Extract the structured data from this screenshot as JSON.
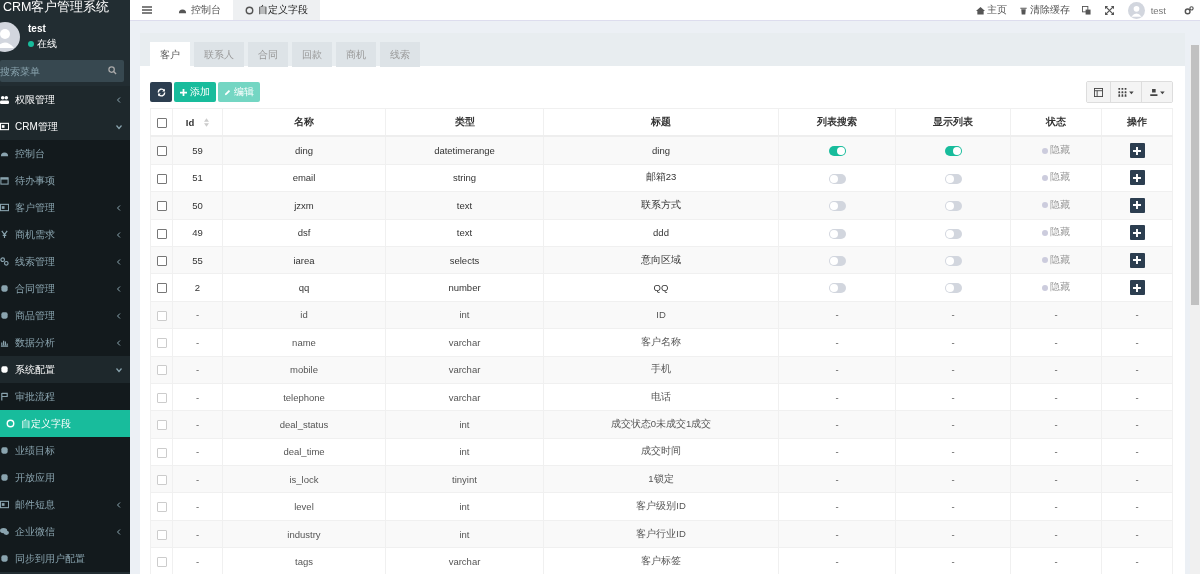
{
  "sidebar": {
    "title": "CRM客户管理系统",
    "user": {
      "name": "test",
      "status": "在线",
      "online": true
    },
    "search": {
      "placeholder": "搜索菜单"
    },
    "items": [
      {
        "label": "权限管理",
        "expanded": false
      },
      {
        "label": "CRM管理",
        "expanded": true,
        "children": [
          {
            "label": "控制台",
            "selected": false
          },
          {
            "label": "待办事项",
            "selected": false
          },
          {
            "label": "客户管理",
            "expanded": false
          },
          {
            "label": "商机需求",
            "expanded": false
          },
          {
            "label": "线索管理",
            "expanded": false
          },
          {
            "label": "合同管理",
            "expanded": false
          },
          {
            "label": "商品管理",
            "expanded": false
          },
          {
            "label": "数据分析",
            "expanded": false
          }
        ]
      },
      {
        "label": "系统配置",
        "expanded": true,
        "children": [
          {
            "label": "审批流程",
            "selected": false
          },
          {
            "label": "自定义字段",
            "selected": true
          },
          {
            "label": "业绩目标",
            "selected": false
          },
          {
            "label": "开放应用",
            "selected": false
          },
          {
            "label": "邮件短息",
            "expanded": false
          },
          {
            "label": "企业微信",
            "expanded": false
          },
          {
            "label": "同步到用户配置",
            "selected": false
          }
        ]
      }
    ]
  },
  "topbar": {
    "tabs": [
      {
        "label": "控制台",
        "selected": false
      },
      {
        "label": "自定义字段",
        "selected": true
      }
    ],
    "links": [
      {
        "label": "主页"
      },
      {
        "label": "清除缓存"
      }
    ],
    "user": "test"
  },
  "content_tabs": [
    {
      "label": "客户",
      "selected": true
    },
    {
      "label": "联系人",
      "selected": false
    },
    {
      "label": "合同",
      "selected": false
    },
    {
      "label": "回款",
      "selected": false
    },
    {
      "label": "商机",
      "selected": false
    },
    {
      "label": "线索",
      "selected": false
    }
  ],
  "toolbar": [
    {
      "kind": "refresh",
      "disabled": false
    },
    {
      "kind": "add",
      "label": "添加",
      "disabled": false
    },
    {
      "kind": "edit",
      "label": "编辑",
      "disabled": true
    }
  ],
  "table": {
    "select_all_checked": false,
    "columns": [
      {
        "label": "Id",
        "sortable": true
      },
      {
        "label": "名称",
        "sortable": false
      },
      {
        "label": "类型",
        "sortable": false
      },
      {
        "label": "标题",
        "sortable": false
      },
      {
        "label": "列表搜索",
        "sortable": false
      },
      {
        "label": "显示列表",
        "sortable": false
      },
      {
        "label": "状态",
        "sortable": false
      },
      {
        "label": "操作",
        "sortable": false
      }
    ],
    "rows": [
      {
        "kind": "custom",
        "checked": false,
        "id": "59",
        "name": "ding",
        "type": "datetimerange",
        "title": "ding",
        "list_search": true,
        "show_list": true,
        "status": "隐藏"
      },
      {
        "kind": "custom",
        "checked": false,
        "id": "51",
        "name": "email",
        "type": "string",
        "title": "邮箱23",
        "list_search": false,
        "show_list": false,
        "status": "隐藏"
      },
      {
        "kind": "custom",
        "checked": false,
        "id": "50",
        "name": "jzxm",
        "type": "text",
        "title": "联系方式",
        "list_search": false,
        "show_list": false,
        "status": "隐藏"
      },
      {
        "kind": "custom",
        "checked": false,
        "id": "49",
        "name": "dsf",
        "type": "text",
        "title": "ddd",
        "list_search": false,
        "show_list": false,
        "status": "隐藏"
      },
      {
        "kind": "custom",
        "checked": false,
        "id": "55",
        "name": "iarea",
        "type": "selects",
        "title": "意向区域",
        "list_search": false,
        "show_list": false,
        "status": "隐藏"
      },
      {
        "kind": "custom",
        "checked": false,
        "id": "2",
        "name": "qq",
        "type": "number",
        "title": "QQ",
        "list_search": false,
        "show_list": false,
        "status": "隐藏"
      },
      {
        "kind": "system",
        "checked": false,
        "id": "-",
        "name": "id",
        "type": "int",
        "title": "ID",
        "list_search": "-",
        "show_list": "-",
        "status": "-",
        "action": "-"
      },
      {
        "kind": "system",
        "checked": false,
        "id": "-",
        "name": "name",
        "type": "varchar",
        "title": "客户名称",
        "list_search": "-",
        "show_list": "-",
        "status": "-",
        "action": "-"
      },
      {
        "kind": "system",
        "checked": false,
        "id": "-",
        "name": "mobile",
        "type": "varchar",
        "title": "手机",
        "list_search": "-",
        "show_list": "-",
        "status": "-",
        "action": "-"
      },
      {
        "kind": "system",
        "checked": false,
        "id": "-",
        "name": "telephone",
        "type": "varchar",
        "title": "电话",
        "list_search": "-",
        "show_list": "-",
        "status": "-",
        "action": "-"
      },
      {
        "kind": "system",
        "checked": false,
        "id": "-",
        "name": "deal_status",
        "type": "int",
        "title": "成交状态0未成交1成交",
        "list_search": "-",
        "show_list": "-",
        "status": "-",
        "action": "-"
      },
      {
        "kind": "system",
        "checked": false,
        "id": "-",
        "name": "deal_time",
        "type": "int",
        "title": "成交时间",
        "list_search": "-",
        "show_list": "-",
        "status": "-",
        "action": "-"
      },
      {
        "kind": "system",
        "checked": false,
        "id": "-",
        "name": "is_lock",
        "type": "tinyint",
        "title": "1锁定",
        "list_search": "-",
        "show_list": "-",
        "status": "-",
        "action": "-"
      },
      {
        "kind": "system",
        "checked": false,
        "id": "-",
        "name": "level",
        "type": "int",
        "title": "客户级别ID",
        "list_search": "-",
        "show_list": "-",
        "status": "-",
        "action": "-"
      },
      {
        "kind": "system",
        "checked": false,
        "id": "-",
        "name": "industry",
        "type": "int",
        "title": "客户行业ID",
        "list_search": "-",
        "show_list": "-",
        "status": "-",
        "action": "-"
      },
      {
        "kind": "system",
        "checked": false,
        "id": "-",
        "name": "tags",
        "type": "varchar",
        "title": "客户标签",
        "list_search": "-",
        "show_list": "-",
        "status": "-",
        "action": "-"
      }
    ]
  }
}
